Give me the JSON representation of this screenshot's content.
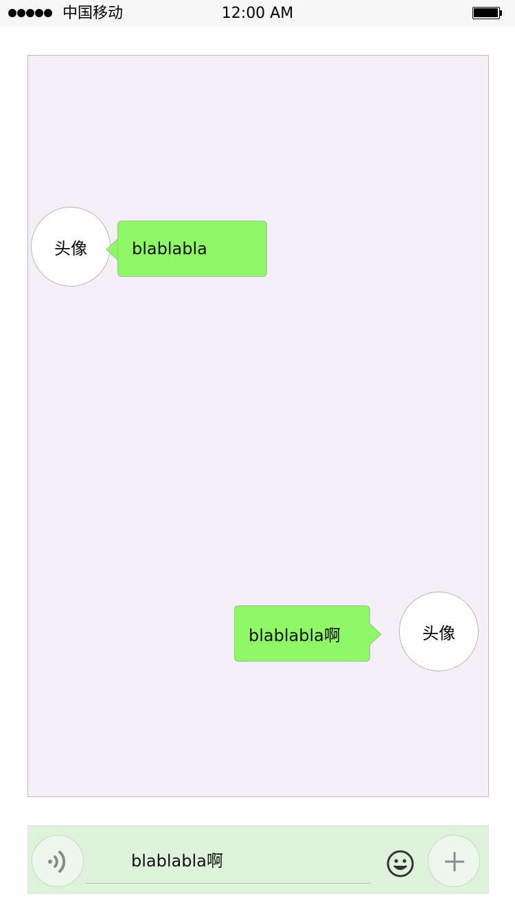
{
  "status_bar": {
    "carrier": "中国移动",
    "time": "12:00 AM"
  },
  "messages": [
    {
      "side": "left",
      "avatar_label": "头像",
      "text": "blablabla"
    },
    {
      "side": "right",
      "avatar_label": "头像",
      "text": "blablabla啊"
    }
  ],
  "input_bar": {
    "text_value": "blablabla啊"
  },
  "colors": {
    "chat_background": "#f5f0f7",
    "bubble": "#8ef866",
    "input_bar_background": "#dff3dc"
  },
  "icons": {
    "signal": "signal-dots-icon",
    "battery": "battery-icon",
    "voice": "voice-icon",
    "emoji": "smiley-icon",
    "plus": "plus-icon"
  }
}
